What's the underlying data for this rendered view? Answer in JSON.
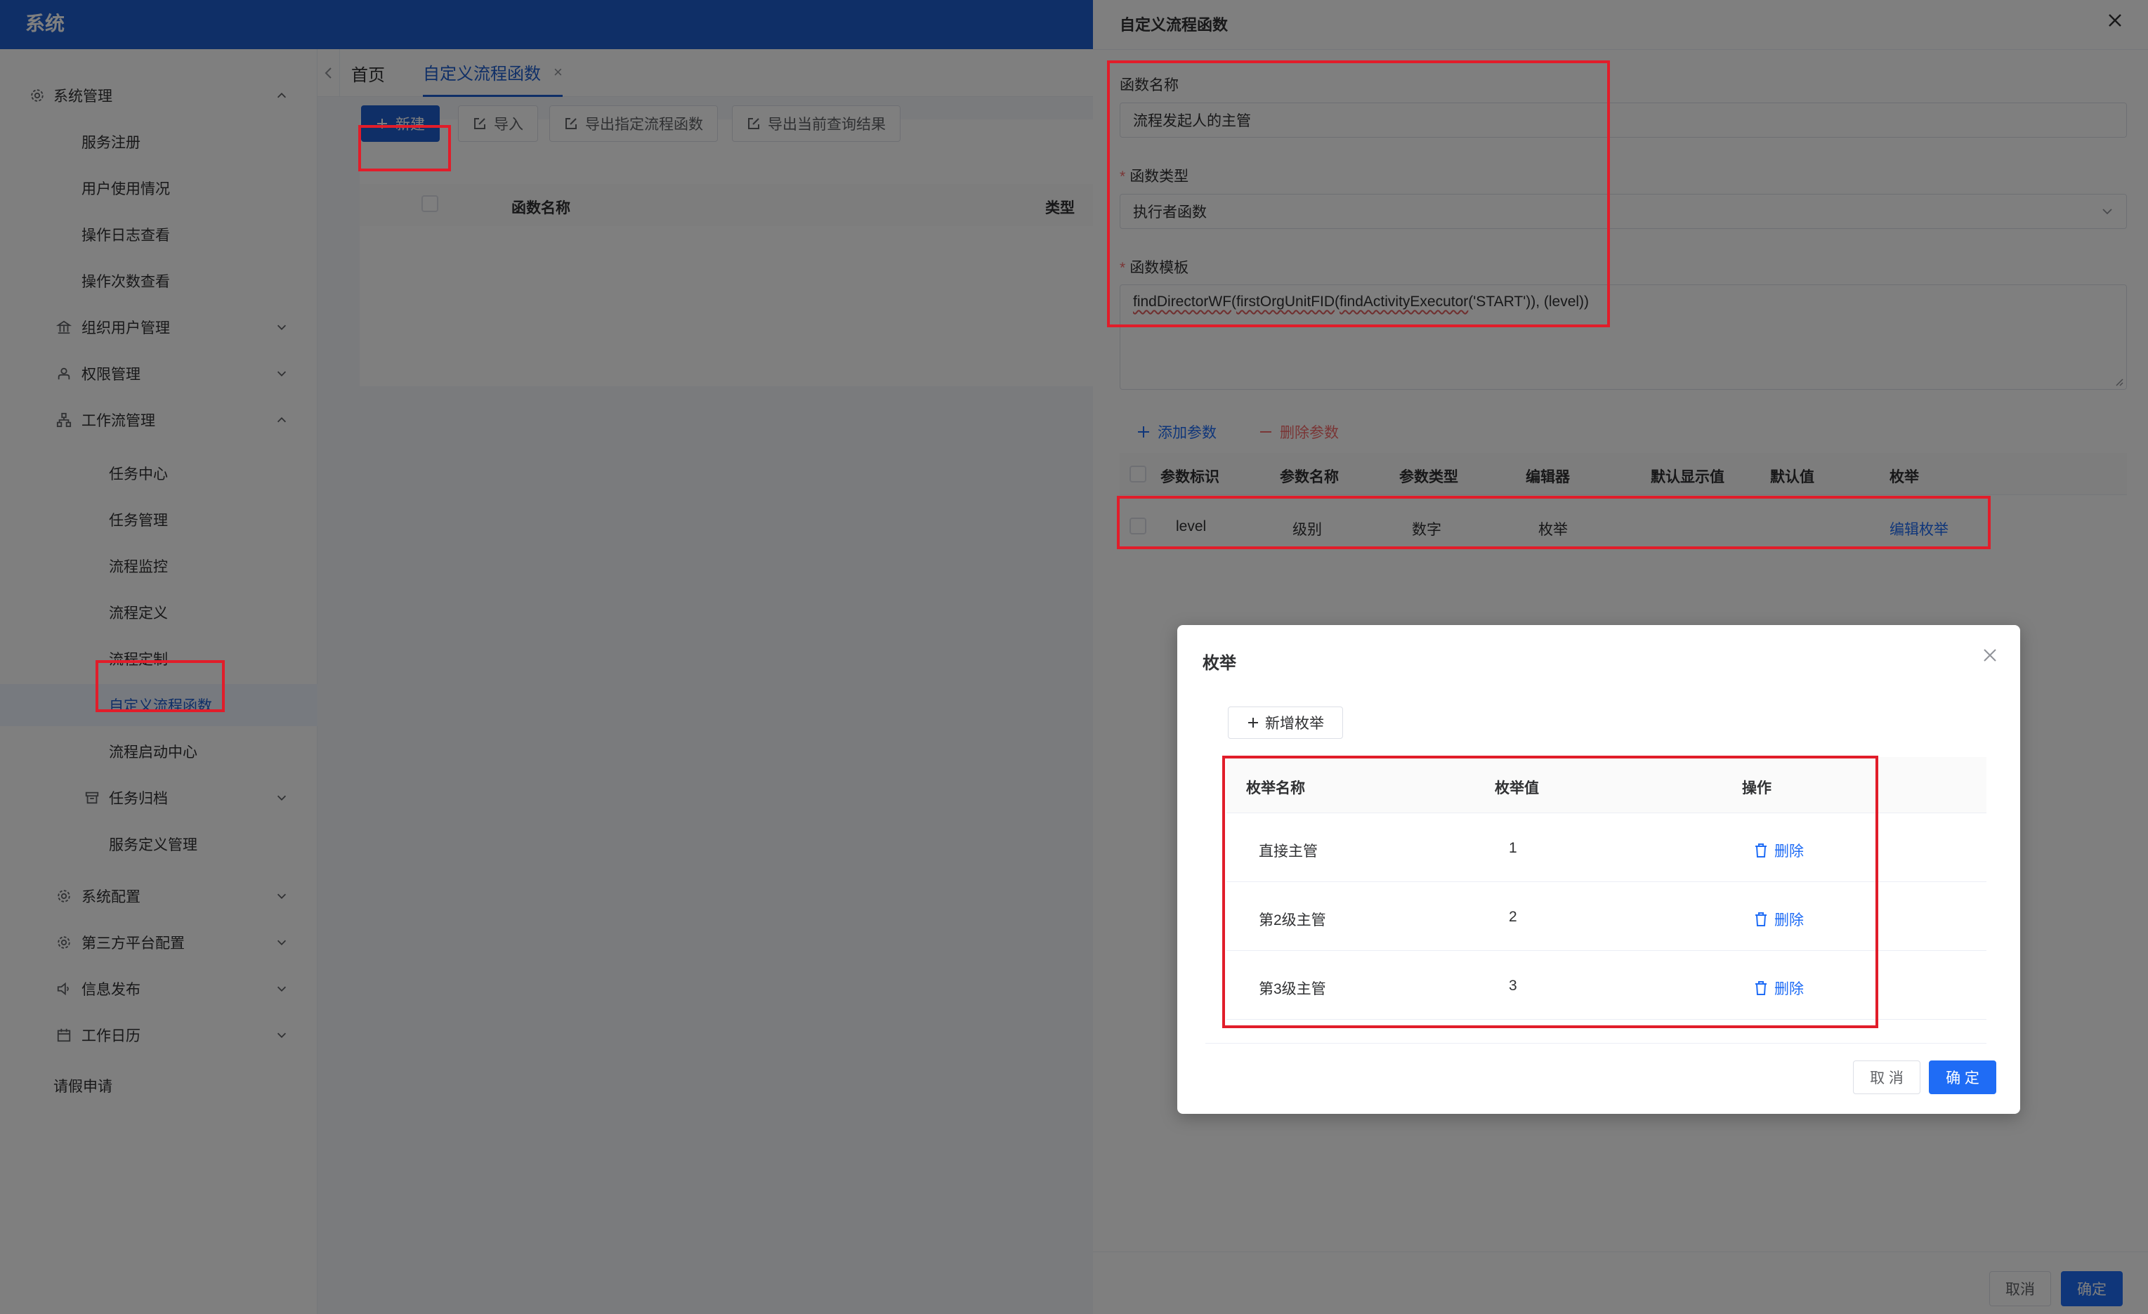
{
  "app": {
    "brand": "系统"
  },
  "sidebar": {
    "items": [
      {
        "label": "系统管理",
        "icon": "gear-icon",
        "expanded": true,
        "level": 0
      },
      {
        "label": "服务注册",
        "level": 1
      },
      {
        "label": "用户使用情况",
        "level": 1
      },
      {
        "label": "操作日志查看",
        "level": 1
      },
      {
        "label": "操作次数查看",
        "level": 1
      },
      {
        "label": "组织用户管理",
        "icon": "building-icon",
        "expanded": false,
        "level": 1
      },
      {
        "label": "权限管理",
        "icon": "user-lock-icon",
        "expanded": false,
        "level": 1
      },
      {
        "label": "工作流管理",
        "icon": "workflow-icon",
        "expanded": true,
        "level": 1
      },
      {
        "label": "任务中心",
        "level": 2
      },
      {
        "label": "任务管理",
        "level": 2
      },
      {
        "label": "流程监控",
        "level": 2
      },
      {
        "label": "流程定义",
        "level": 2
      },
      {
        "label": "流程定制",
        "level": 2
      },
      {
        "label": "自定义流程函数",
        "level": 2,
        "active": true
      },
      {
        "label": "流程启动中心",
        "level": 2
      },
      {
        "label": "任务归档",
        "icon": "archive-icon",
        "expanded": false,
        "level": 1
      },
      {
        "label": "服务定义管理",
        "level": 2
      },
      {
        "label": "系统配置",
        "icon": "gear-icon",
        "expanded": false,
        "level": 1
      },
      {
        "label": "第三方平台配置",
        "icon": "gear-icon",
        "expanded": false,
        "level": 1
      },
      {
        "label": "信息发布",
        "icon": "speaker-icon",
        "expanded": false,
        "level": 1
      },
      {
        "label": "工作日历",
        "icon": "calendar-icon",
        "expanded": false,
        "level": 1
      },
      {
        "label": "请假申请",
        "level": 0
      }
    ]
  },
  "tabs": {
    "home": "首页",
    "current": "自定义流程函数"
  },
  "toolbar": {
    "new": "新建",
    "import": "导入",
    "export_selected": "导出指定流程函数",
    "export_query": "导出当前查询结果"
  },
  "list_table": {
    "col_name": "函数名称",
    "col_type": "类型"
  },
  "drawer": {
    "title": "自定义流程函数",
    "name_label": "函数名称",
    "name_value": "流程发起人的主管",
    "type_label": "函数类型",
    "type_value": "执行者函数",
    "template_label": "函数模板",
    "template_parts": {
      "f1": "findDirectorWF",
      "p1": "(",
      "f2": "firstOrgUnitFID",
      "p2": "(",
      "f3": "findActivityExecutor",
      "rest": "('START')), (level))"
    },
    "add_param": "添加参数",
    "remove_param": "删除参数",
    "param_columns": [
      "参数标识",
      "参数名称",
      "参数类型",
      "编辑器",
      "默认显示值",
      "默认值",
      "枚举"
    ],
    "param_row": {
      "id": "level",
      "name": "级别",
      "type": "数字",
      "editor": "枚举",
      "display": "",
      "default": "",
      "enum_link": "编辑枚举"
    },
    "cancel": "取消",
    "confirm": "确定"
  },
  "dialog": {
    "title": "枚举",
    "add_enum": "新增枚举",
    "columns": {
      "name": "枚举名称",
      "value": "枚举值",
      "action": "操作"
    },
    "rows": [
      {
        "name": "直接主管",
        "value": "1",
        "action": "删除"
      },
      {
        "name": "第2级主管",
        "value": "2",
        "action": "删除"
      },
      {
        "name": "第3级主管",
        "value": "3",
        "action": "删除"
      }
    ],
    "cancel": "取 消",
    "confirm": "确 定"
  },
  "colors": {
    "primary": "#1f6cf5",
    "brand": "#1f5ecf",
    "danger": "#f56c6c",
    "annotation": "#e11d2a"
  }
}
